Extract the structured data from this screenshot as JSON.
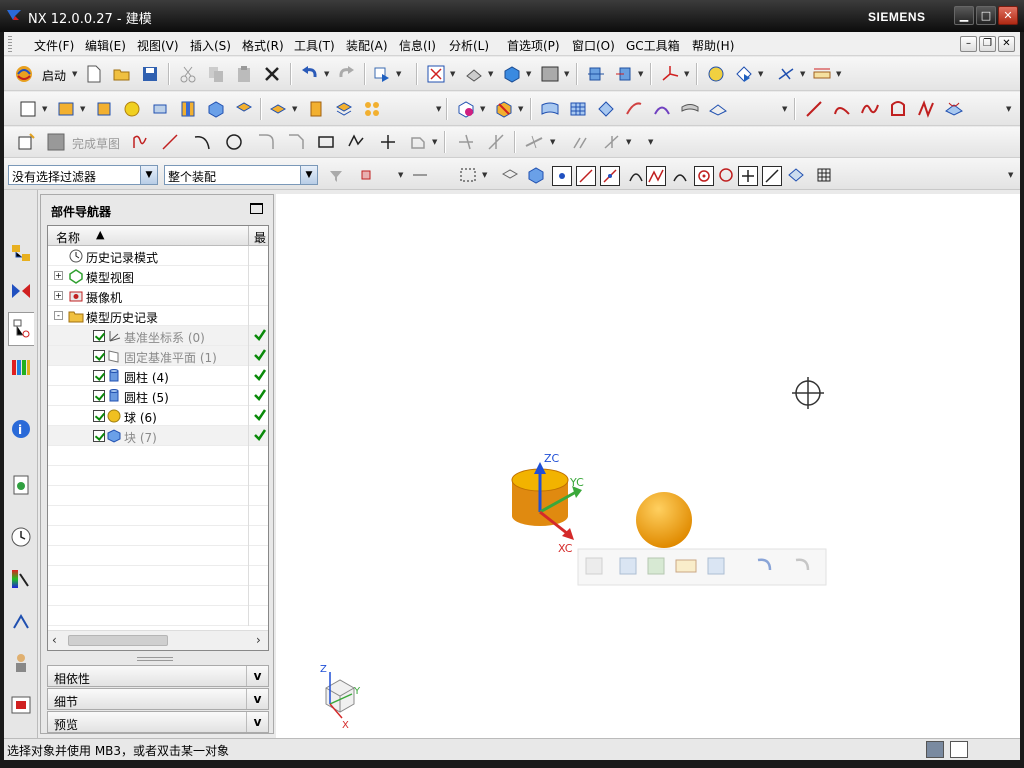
{
  "window": {
    "title": "NX 12.0.0.27 - 建模",
    "brand": "SIEMENS"
  },
  "menu": [
    "文件(F)",
    "编辑(E)",
    "视图(V)",
    "插入(S)",
    "格式(R)",
    "工具(T)",
    "装配(A)",
    "信息(I)",
    "分析(L)",
    "首选项(P)",
    "窗口(O)",
    "GC工具箱",
    "帮助(H)"
  ],
  "toolbar": {
    "start_label": "启动",
    "finish_sketch_label": "完成草图"
  },
  "selection_bar": {
    "filter_value": "没有选择过滤器",
    "scope_value": "整个装配"
  },
  "navigator": {
    "title": "部件导航器",
    "col_name": "名称",
    "col_latest": "最",
    "rows": [
      {
        "label": "历史记录模式",
        "indent": 0,
        "icon": "clock-icon",
        "expander": "",
        "check": false,
        "ok": false,
        "dim": false
      },
      {
        "label": "模型视图",
        "indent": 0,
        "icon": "model-view-icon",
        "expander": "+",
        "check": false,
        "ok": false,
        "dim": false
      },
      {
        "label": "摄像机",
        "indent": 0,
        "icon": "camera-icon",
        "expander": "+",
        "check": false,
        "ok": false,
        "dim": false
      },
      {
        "label": "模型历史记录",
        "indent": 0,
        "icon": "folder-icon",
        "expander": "-",
        "check": false,
        "ok": false,
        "dim": false
      },
      {
        "label": "基准坐标系 (0)",
        "indent": 1,
        "icon": "datum-csys-icon",
        "expander": "",
        "check": true,
        "ok": true,
        "dim": true
      },
      {
        "label": "固定基准平面 (1)",
        "indent": 1,
        "icon": "datum-plane-icon",
        "expander": "",
        "check": true,
        "ok": true,
        "dim": true
      },
      {
        "label": "圆柱 (4)",
        "indent": 1,
        "icon": "cylinder-icon",
        "expander": "",
        "check": true,
        "ok": true,
        "dim": false
      },
      {
        "label": "圆柱 (5)",
        "indent": 1,
        "icon": "cylinder-icon",
        "expander": "",
        "check": true,
        "ok": true,
        "dim": false
      },
      {
        "label": "球 (6)",
        "indent": 1,
        "icon": "sphere-icon",
        "expander": "",
        "check": true,
        "ok": true,
        "dim": false
      },
      {
        "label": "块 (7)",
        "indent": 1,
        "icon": "block-icon",
        "expander": "",
        "check": true,
        "ok": true,
        "dim": true
      }
    ],
    "panels": [
      "相依性",
      "细节",
      "预览"
    ]
  },
  "viewport": {
    "axes": {
      "zc": "ZC",
      "yc": "YC",
      "xc": "XC"
    },
    "triad": {
      "z": "Z",
      "y": "Y",
      "x": "X"
    }
  },
  "status": {
    "prompt": "选择对象并使用 MB3，或者双击某一对象"
  },
  "colors": {
    "selected_check": "#0a8a0a",
    "axis_z": "#1f4fd6",
    "axis_y": "#3aa83a",
    "axis_x": "#d42a2a",
    "cylinder_top": "#f2b300",
    "sphere": "#f5a000"
  }
}
